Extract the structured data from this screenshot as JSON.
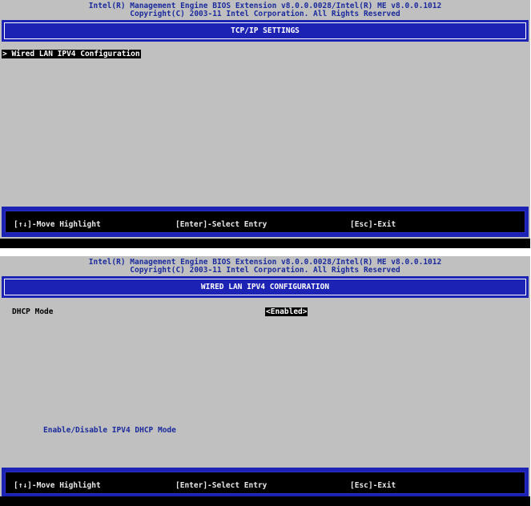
{
  "header": {
    "line1": "Intel(R) Management Engine BIOS Extension v8.0.0.0028/Intel(R) ME v8.0.0.1012",
    "line2": "Copyright(C) 2003-11 Intel Corporation. All Rights Reserved"
  },
  "screen1": {
    "title": "TCP/IP SETTINGS",
    "menu_item": "> Wired LAN IPV4 Configuration"
  },
  "screen2": {
    "title": "WIRED LAN IPV4 CONFIGURATION",
    "field_label": "DHCP Mode",
    "field_value": "<Enabled>",
    "help_text": "Enable/Disable IPV4 DHCP Mode"
  },
  "footer": {
    "move": "[↑↓]-Move Highlight",
    "select": "[Enter]-Select Entry",
    "exit": "[Esc]-Exit"
  },
  "colors": {
    "background": "#c0c0c0",
    "title_bar": "#1c22b4",
    "header_text": "#1b2b9c",
    "highlight": "#000000"
  }
}
